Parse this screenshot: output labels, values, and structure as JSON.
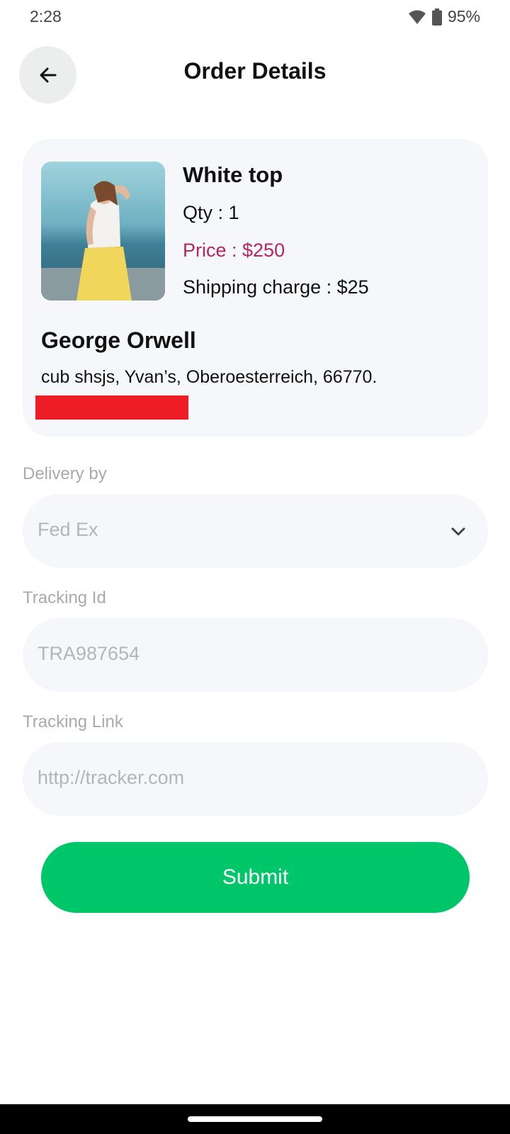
{
  "status_bar": {
    "time": "2:28",
    "battery": "95%",
    "icons": [
      "wifi-icon",
      "battery-icon"
    ]
  },
  "header": {
    "title": "Order Details",
    "back_icon": "arrow-left-icon"
  },
  "order": {
    "product_name": "White top",
    "qty": "Qty : 1",
    "price": "Price : $250",
    "shipping": "Shipping charge : $25",
    "customer_name": "George Orwell",
    "address": "cub shsjs, Yvan’s, Oberoesterreich, 66770."
  },
  "form": {
    "delivery": {
      "label": "Delivery by",
      "value": "Fed Ex",
      "icon": "chevron-down-icon"
    },
    "tracking_id": {
      "label": "Tracking Id",
      "placeholder": "TRA987654"
    },
    "tracking_link": {
      "label": "Tracking Link",
      "placeholder": "http://tracker.com"
    },
    "submit_label": "Submit"
  },
  "colors": {
    "accent_green": "#00c66a",
    "price_color": "#b3275f",
    "card_background": "#f6f7fb",
    "redaction": "#ee1c25"
  }
}
